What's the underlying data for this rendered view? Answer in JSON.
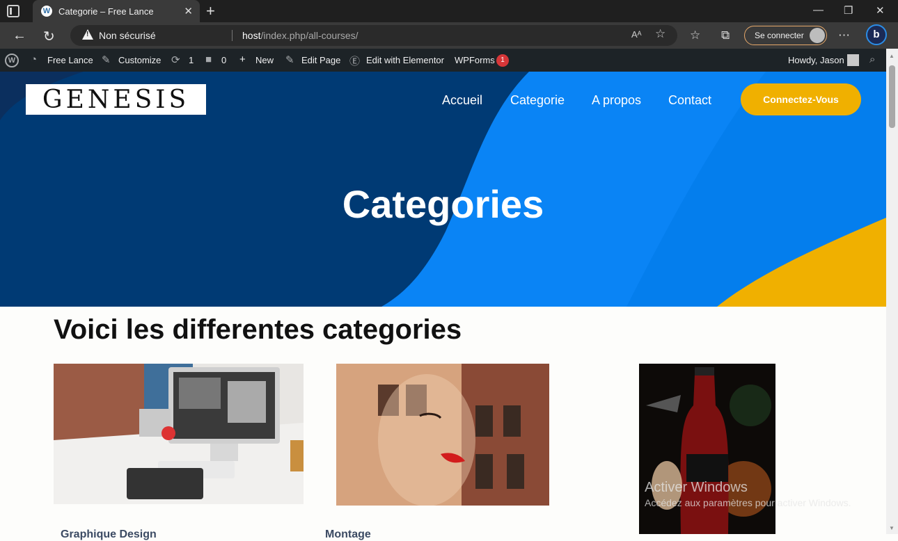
{
  "browser": {
    "tab_title": "Categorie – Free Lance",
    "new_tab": "+",
    "security_label": "Non sécurisé",
    "url_host": "host",
    "url_path": "/index.php/all-courses/",
    "signin_label": "Se connecter",
    "read_aloud": "Aᴬ",
    "window_controls": [
      "—",
      "❐",
      "✕"
    ]
  },
  "wp_admin_bar": {
    "site_name": "Free Lance",
    "customize": "Customize",
    "updates_count": "1",
    "comments_count": "0",
    "new_label": "New",
    "edit_page": "Edit Page",
    "edit_elementor": "Edit with Elementor",
    "wpforms": "WPForms",
    "wpforms_badge": "1",
    "howdy": "Howdy, Jason"
  },
  "header": {
    "logo_text": "GENESIS",
    "menu": [
      "Accueil",
      "Categorie",
      "A propos",
      "Contact"
    ],
    "cta_label": "Connectez-Vous"
  },
  "hero": {
    "title": "Categories",
    "colors": {
      "dark_blue": "#003a74",
      "bright_blue": "#0a84f5",
      "yellow": "#f0b000"
    }
  },
  "main": {
    "section_title": "Voici les differentes categories",
    "cards": [
      {
        "label": "Graphique Design",
        "image": "designer-desk-photo"
      },
      {
        "label": "Montage ",
        "image": "double-exposure-portrait-photo"
      },
      {
        "label": "",
        "image": "coca-cola-zero-ad-photo"
      }
    ]
  },
  "os_watermark": {
    "line1": "Activer Windows",
    "line2": "Accédez aux paramètres pour activer Windows."
  }
}
